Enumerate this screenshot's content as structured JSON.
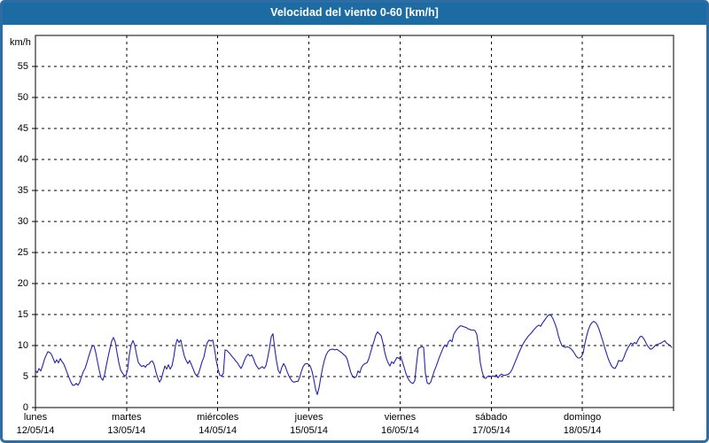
{
  "window": {
    "title": "Velocidad del viento 0-60 [km/h]"
  },
  "colors": {
    "frame": "#2e6da4",
    "title_bar": "#1d6ba3",
    "title_text": "#ffffff",
    "plot_background": "#ffffff",
    "grid": "#000000",
    "axis": "#000000",
    "line": "#2424ad",
    "label_text": "#000000"
  },
  "chart_data": {
    "type": "line",
    "title": "Velocidad del viento 0-60 [km/h]",
    "ylabel": "km/h",
    "ylim": [
      0,
      60
    ],
    "y_ticks": [
      0,
      5,
      10,
      15,
      20,
      25,
      30,
      35,
      40,
      45,
      50,
      55
    ],
    "grid": "dashed-black-both-axes",
    "legend": "none",
    "days": [
      {
        "name": "lunes",
        "date": "12/05/14"
      },
      {
        "name": "martes",
        "date": "13/05/14"
      },
      {
        "name": "miércoles",
        "date": "14/05/14"
      },
      {
        "name": "jueves",
        "date": "15/05/14"
      },
      {
        "name": "viernes",
        "date": "16/05/14"
      },
      {
        "name": "sábado",
        "date": "17/05/14"
      },
      {
        "name": "domingo",
        "date": "18/05/14"
      }
    ],
    "series": [
      {
        "name": "Velocidad del viento [km/h]",
        "color": "#2424ad",
        "values": [
          6.0,
          5.6,
          6.3,
          5.9,
          6.7,
          7.7,
          8.4,
          9.0,
          8.9,
          8.6,
          7.9,
          7.2,
          7.7,
          7.2,
          7.9,
          7.4,
          7.0,
          6.3,
          5.5,
          4.8,
          4.1,
          3.6,
          3.6,
          3.9,
          3.6,
          4.1,
          5.0,
          5.8,
          6.3,
          7.2,
          8.2,
          9.1,
          9.9,
          10.0,
          8.9,
          7.4,
          6.0,
          4.8,
          4.4,
          5.3,
          6.8,
          8.2,
          9.5,
          10.7,
          11.3,
          10.6,
          8.9,
          7.3,
          6.1,
          5.6,
          5.2,
          5.1,
          6.1,
          8.6,
          10.1,
          10.8,
          10.1,
          8.6,
          7.3,
          6.9,
          6.6,
          6.8,
          6.5,
          6.9,
          7.0,
          7.4,
          7.5,
          6.9,
          5.7,
          4.8,
          4.1,
          4.6,
          5.7,
          6.7,
          6.2,
          6.9,
          6.2,
          6.7,
          8.1,
          10.0,
          11.0,
          10.5,
          10.9,
          9.5,
          8.3,
          7.6,
          7.1,
          7.6,
          6.9,
          6.2,
          5.5,
          5.1,
          5.5,
          6.4,
          7.4,
          8.1,
          9.5,
          10.5,
          10.9,
          10.7,
          10.9,
          9.5,
          7.6,
          6.2,
          5.2,
          5.1,
          5.5,
          9.3,
          9.2,
          8.9,
          8.6,
          8.2,
          7.9,
          7.5,
          7.2,
          6.7,
          6.3,
          6.9,
          7.7,
          8.3,
          8.6,
          8.3,
          8.5,
          7.9,
          7.1,
          6.6,
          6.2,
          6.4,
          6.6,
          6.3,
          6.7,
          8.0,
          9.5,
          11.4,
          11.9,
          9.5,
          7.5,
          6.0,
          5.5,
          6.5,
          7.1,
          6.6,
          5.8,
          5.1,
          4.6,
          4.2,
          4.1,
          4.2,
          4.2,
          4.8,
          5.8,
          6.6,
          7.0,
          7.1,
          7.0,
          6.7,
          5.9,
          4.6,
          3.0,
          2.1,
          3.2,
          4.9,
          6.4,
          7.6,
          8.5,
          9.0,
          9.3,
          9.4,
          9.4,
          9.3,
          9.4,
          9.2,
          9.0,
          8.8,
          8.5,
          8.3,
          7.7,
          6.6,
          5.6,
          5.0,
          4.8,
          5.0,
          5.9,
          5.6,
          6.5,
          6.9,
          7.1,
          7.2,
          7.8,
          8.8,
          9.8,
          10.7,
          11.7,
          12.2,
          11.9,
          11.6,
          10.5,
          9.0,
          7.9,
          7.2,
          6.7,
          7.4,
          7.1,
          7.6,
          8.1,
          7.9,
          8.3,
          7.4,
          6.5,
          5.5,
          4.8,
          4.3,
          4.0,
          3.9,
          4.3,
          7.1,
          9.5,
          9.7,
          9.8,
          9.7,
          5.5,
          4.0,
          3.8,
          4.1,
          5.0,
          5.9,
          6.6,
          7.4,
          8.2,
          8.9,
          9.6,
          10.1,
          9.8,
          10.6,
          10.9,
          10.6,
          11.8,
          12.3,
          12.7,
          13.0,
          13.2,
          13.1,
          13.0,
          12.9,
          12.7,
          12.6,
          12.5,
          12.5,
          12.4,
          11.8,
          9.8,
          7.2,
          5.8,
          4.8,
          4.7,
          5.0,
          5.1,
          5.0,
          5.1,
          5.0,
          5.3,
          4.8,
          5.2,
          5.4,
          5.2,
          5.2,
          5.3,
          5.4,
          5.7,
          6.2,
          6.9,
          7.6,
          8.3,
          9.0,
          9.6,
          10.2,
          10.7,
          11.1,
          11.5,
          11.8,
          12.1,
          12.5,
          12.8,
          13.1,
          13.3,
          13.1,
          13.6,
          14.0,
          14.4,
          14.8,
          15.0,
          14.8,
          14.3,
          13.6,
          12.8,
          11.6,
          10.7,
          10.0,
          9.8,
          9.7,
          9.8,
          9.7,
          9.5,
          9.2,
          8.8,
          8.3,
          8.0,
          8.0,
          8.2,
          8.8,
          10.3,
          11.6,
          12.6,
          13.3,
          13.7,
          13.9,
          13.7,
          13.3,
          12.6,
          11.7,
          10.8,
          9.8,
          8.9,
          8.0,
          7.3,
          6.7,
          6.4,
          6.3,
          6.8,
          7.6,
          7.5,
          7.5,
          8.1,
          8.9,
          9.5,
          10.0,
          10.4,
          10.2,
          10.5,
          10.3,
          10.9,
          11.4,
          11.5,
          11.2,
          10.7,
          10.1,
          9.7,
          9.4,
          9.5,
          9.8,
          10.1,
          10.2,
          10.3,
          10.4,
          10.6,
          10.8,
          10.4,
          10.2,
          10.0,
          9.7
        ]
      }
    ]
  }
}
